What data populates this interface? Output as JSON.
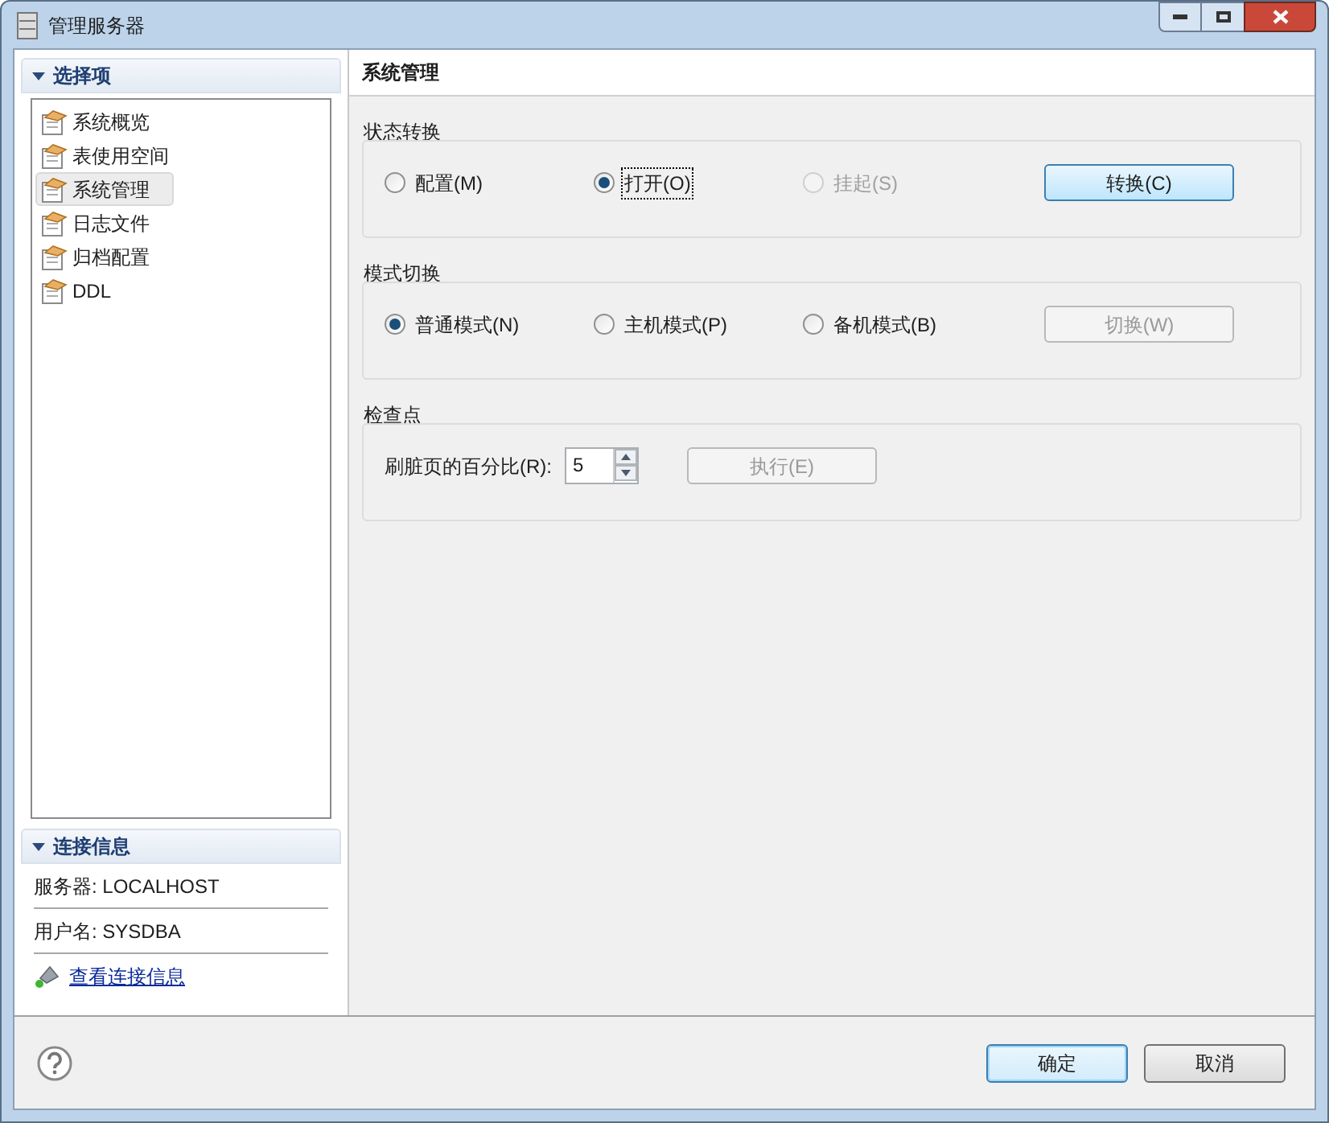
{
  "window": {
    "title": "管理服务器"
  },
  "sidebar": {
    "header": "选择项",
    "items": [
      {
        "label": "系统概览",
        "selected": false
      },
      {
        "label": "表使用空间",
        "selected": false
      },
      {
        "label": "系统管理",
        "selected": true
      },
      {
        "label": "日志文件",
        "selected": false
      },
      {
        "label": "归档配置",
        "selected": false
      },
      {
        "label": "DDL",
        "selected": false
      }
    ]
  },
  "connection": {
    "header": "连接信息",
    "rows": [
      "服务器: LOCALHOST",
      "用户名: SYSDBA"
    ],
    "link": "查看连接信息"
  },
  "panel": {
    "title": "系统管理",
    "groups": [
      {
        "title": "状态转换",
        "kind": "radios",
        "options": [
          {
            "label": "配置(M)",
            "selected": false,
            "disabled": false,
            "focused": false
          },
          {
            "label": "打开(O)",
            "selected": true,
            "disabled": false,
            "focused": true
          },
          {
            "label": "挂起(S)",
            "selected": false,
            "disabled": true,
            "focused": false
          }
        ],
        "button": {
          "label": "转换(C)",
          "disabled": false,
          "highlighted": true
        }
      },
      {
        "title": "模式切换",
        "kind": "radios",
        "options": [
          {
            "label": "普通模式(N)",
            "selected": true,
            "disabled": false,
            "focused": false
          },
          {
            "label": "主机模式(P)",
            "selected": false,
            "disabled": false,
            "focused": false
          },
          {
            "label": "备机模式(B)",
            "selected": false,
            "disabled": false,
            "focused": false
          }
        ],
        "button": {
          "label": "切换(W)",
          "disabled": true,
          "highlighted": false
        }
      },
      {
        "title": "检查点",
        "kind": "spinner",
        "field_label": "刷脏页的百分比(R):",
        "value": "5",
        "button": {
          "label": "执行(E)",
          "disabled": true,
          "highlighted": false
        }
      }
    ]
  },
  "buttons": [
    {
      "label": "确定",
      "default": true
    },
    {
      "label": "取消",
      "default": false
    }
  ]
}
